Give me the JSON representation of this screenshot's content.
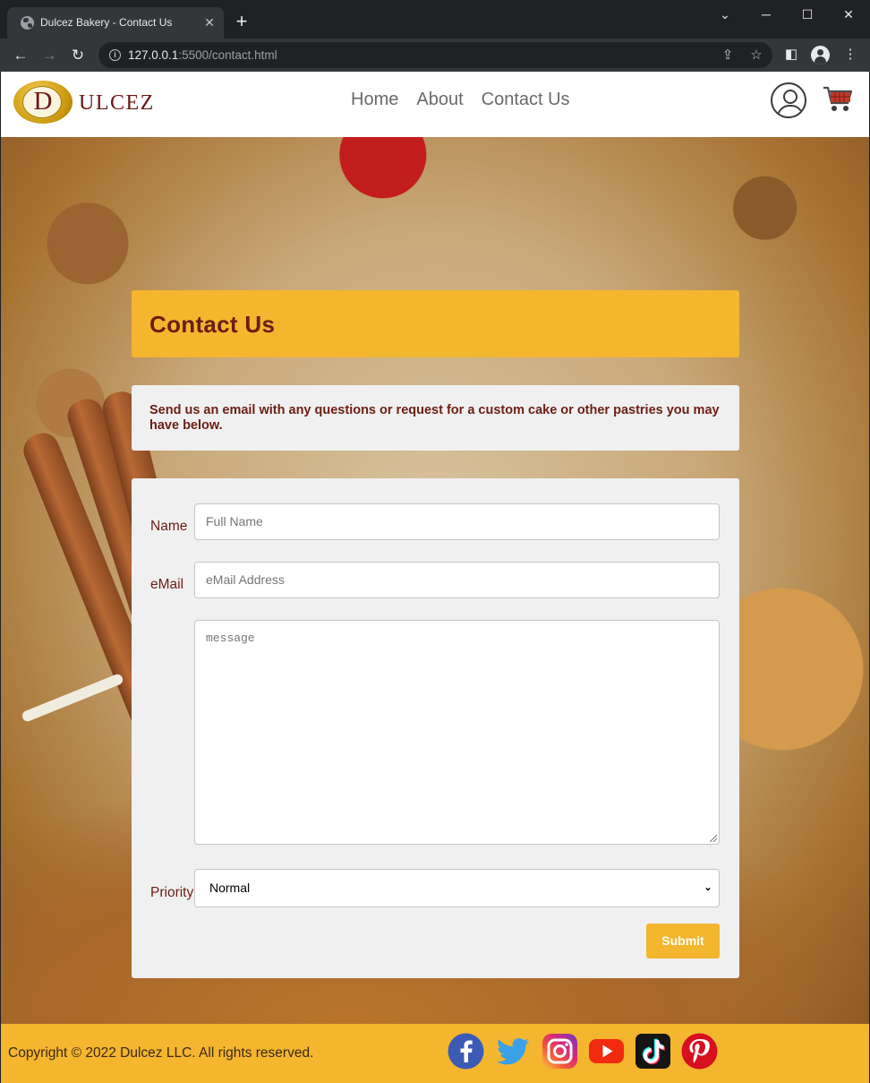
{
  "browser": {
    "tab_title": "Dulcez Bakery - Contact Us",
    "url_host": "127.0.0.1",
    "url_path": ":5500/contact.html",
    "new_tab": "+",
    "close_tab": "✕",
    "win_chevron": "⌄",
    "win_min": "─",
    "win_max": "☐",
    "win_close": "✕",
    "back": "←",
    "forward": "→",
    "reload": "↻",
    "share": "⇪",
    "star": "☆",
    "sidebar": "◧",
    "menu": "⋮"
  },
  "header": {
    "logo_letter": "D",
    "logo_rest": "ULCEZ",
    "nav": [
      {
        "label": "Home"
      },
      {
        "label": "About"
      },
      {
        "label": "Contact Us"
      }
    ]
  },
  "page": {
    "title": "Contact Us",
    "intro": "Send us an email with any questions or request for a custom cake or other pastries you may have below."
  },
  "form": {
    "name_label": "Name",
    "name_placeholder": "Full Name",
    "email_label": "eMail",
    "email_placeholder": "eMail Address",
    "message_placeholder": "message",
    "priority_label": "Priority",
    "priority_value": "Normal",
    "submit_label": "Submit"
  },
  "footer": {
    "copyright": "Copyright © 2022 Dulcez LLC. All rights reserved.",
    "social": [
      "facebook-icon",
      "twitter-icon",
      "instagram-icon",
      "youtube-icon",
      "tiktok-icon",
      "pinterest-icon"
    ]
  },
  "colors": {
    "accent": "#f4b52f",
    "brand_text": "#6b1e14",
    "panel_bg": "#f0f0f0"
  }
}
